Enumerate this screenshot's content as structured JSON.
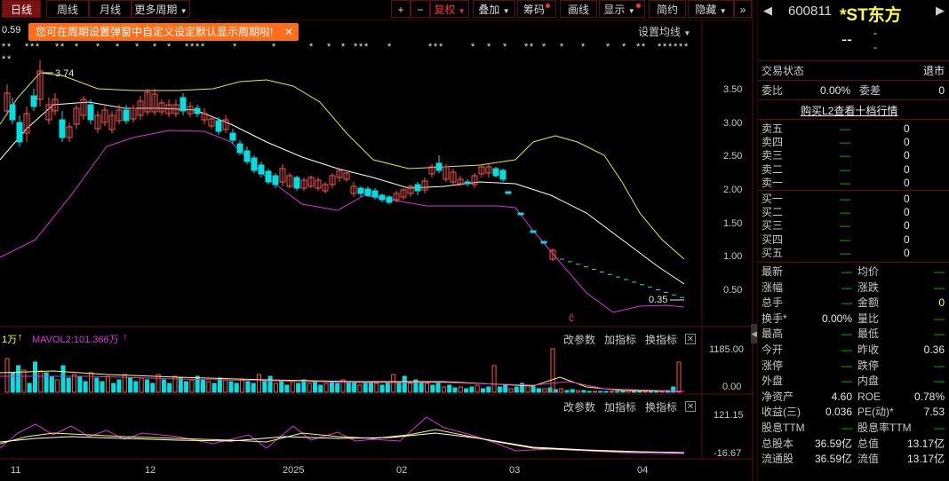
{
  "toolbar": {
    "day": "日线",
    "week": "周线",
    "month": "月线",
    "more": "更多周期",
    "plus": "+",
    "minus": "−",
    "fuquan": "复权",
    "overlay": "叠加",
    "chips": "筹码",
    "draw": "画线",
    "display": "显示",
    "simple": "简约",
    "hide": "隐藏"
  },
  "tip": {
    "text": "您可在周期设置弹窗中自定义设定默认显示周期啦!",
    "close": "✕"
  },
  "main_chart": {
    "left_value": "0.59",
    "ma_setting": "设置均线",
    "high_label": "3.74",
    "low_label": "0.35",
    "axis": [
      "3.50",
      "3.00",
      "2.50",
      "2.00",
      "1.50",
      "1.00",
      "0.50"
    ]
  },
  "volume": {
    "legend_a": "1万",
    "legend_b": "MAVOL2:101.366万",
    "arrow_icon": "up-arrow-icon",
    "btn_param": "改参数",
    "btn_add": "加指标",
    "btn_switch": "换指标",
    "close": "✕",
    "axis_top": "1185.00",
    "axis_bottom": "0.00"
  },
  "indicator": {
    "btn_param": "改参数",
    "btn_add": "加指标",
    "btn_switch": "换指标",
    "close": "✕",
    "axis_top": "121.15",
    "axis_bottom": "-16.67"
  },
  "dates": [
    "11",
    "12",
    "2025",
    "02",
    "03",
    "04"
  ],
  "panel": {
    "code": "600811",
    "name": "*ST东方",
    "price": "--",
    "chg1": "-",
    "chg2": "-",
    "status_label": "交易状态",
    "status_value": "退市",
    "weibi_label": "委比",
    "weibi_value": "0.00%",
    "weicha_label": "委差",
    "weicha_value": "0",
    "l2_link": "购买L2查看十档行情",
    "sells": [
      {
        "label": "卖五",
        "price": "—",
        "vol": "0"
      },
      {
        "label": "卖四",
        "price": "—",
        "vol": "0"
      },
      {
        "label": "卖三",
        "price": "—",
        "vol": "0"
      },
      {
        "label": "卖二",
        "price": "—",
        "vol": "0"
      },
      {
        "label": "卖一",
        "price": "—",
        "vol": "0"
      }
    ],
    "buys": [
      {
        "label": "买一",
        "price": "—",
        "vol": "0"
      },
      {
        "label": "买二",
        "price": "—",
        "vol": "0"
      },
      {
        "label": "买三",
        "price": "—",
        "vol": "0"
      },
      {
        "label": "买四",
        "price": "—",
        "vol": "0"
      },
      {
        "label": "买五",
        "price": "—",
        "vol": "0"
      }
    ],
    "stats": [
      {
        "l1": "最新",
        "v1": "—",
        "l2": "均价",
        "v2": "—"
      },
      {
        "l1": "涨幅",
        "v1": "—",
        "l2": "涨跌",
        "v2": "—"
      },
      {
        "l1": "总手",
        "v1": "—",
        "l2": "金额",
        "v2": "0"
      },
      {
        "l1": "换手*",
        "v1": "0.00%",
        "l2": "量比",
        "v2": "—"
      },
      {
        "l1": "最高",
        "v1": "—",
        "l2": "最低",
        "v2": "—"
      },
      {
        "l1": "今开",
        "v1": "—",
        "l2": "昨收",
        "v2": "0.36"
      },
      {
        "l1": "涨停",
        "v1": "—",
        "l2": "跌停",
        "v2": "—"
      },
      {
        "l1": "外盘",
        "v1": "—",
        "l2": "内盘",
        "v2": "—"
      },
      {
        "l1": "净资产",
        "v1": "4.60",
        "l2": "ROE",
        "v2": "0.78%"
      },
      {
        "l1": "收益(三)",
        "v1": "0.036",
        "l2": "PE(动)*",
        "v2": "7.53"
      },
      {
        "l1": "股息TTM",
        "v1": "—",
        "l2": "股息率TTM",
        "v2": "—"
      },
      {
        "l1": "总股本",
        "v1": "36.59亿",
        "l2": "总值",
        "v2": "13.17亿"
      },
      {
        "l1": "流通股",
        "v1": "36.59亿",
        "l2": "流值",
        "v2": "13.17亿"
      }
    ]
  },
  "colors": {
    "up": "#ff5050",
    "down": "#00e0e0",
    "ma1": "#ffffff",
    "ma2": "#e8e830",
    "ma3": "#e030e0"
  }
}
